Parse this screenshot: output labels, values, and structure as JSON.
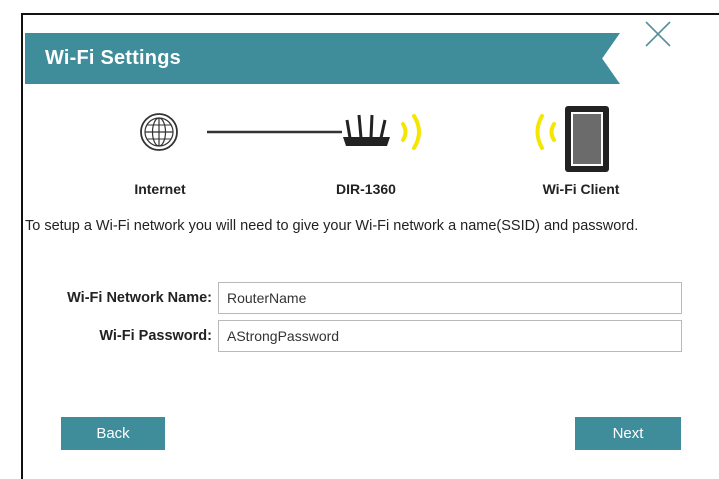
{
  "dialog": {
    "title": "Wi-Fi Settings",
    "close_icon": "close-icon",
    "diagram": {
      "internet_label": "Internet",
      "router_label": "DIR-1360",
      "client_label": "Wi-Fi Client",
      "icons": [
        "globe-icon",
        "router-icon",
        "wifi-signal-icon",
        "tablet-icon"
      ],
      "signal_color": "#f5e600"
    },
    "intro_text": "To setup a Wi-Fi network you will need to give your Wi-Fi network a name(SSID) and password.",
    "fields": {
      "network_name_label": "Wi-Fi Network Name:",
      "network_name_value": "RouterName",
      "password_label": "Wi-Fi Password:",
      "password_value": "AStrongPassword"
    },
    "buttons": {
      "back": "Back",
      "next": "Next"
    },
    "accent_color": "#3f8c9b"
  }
}
